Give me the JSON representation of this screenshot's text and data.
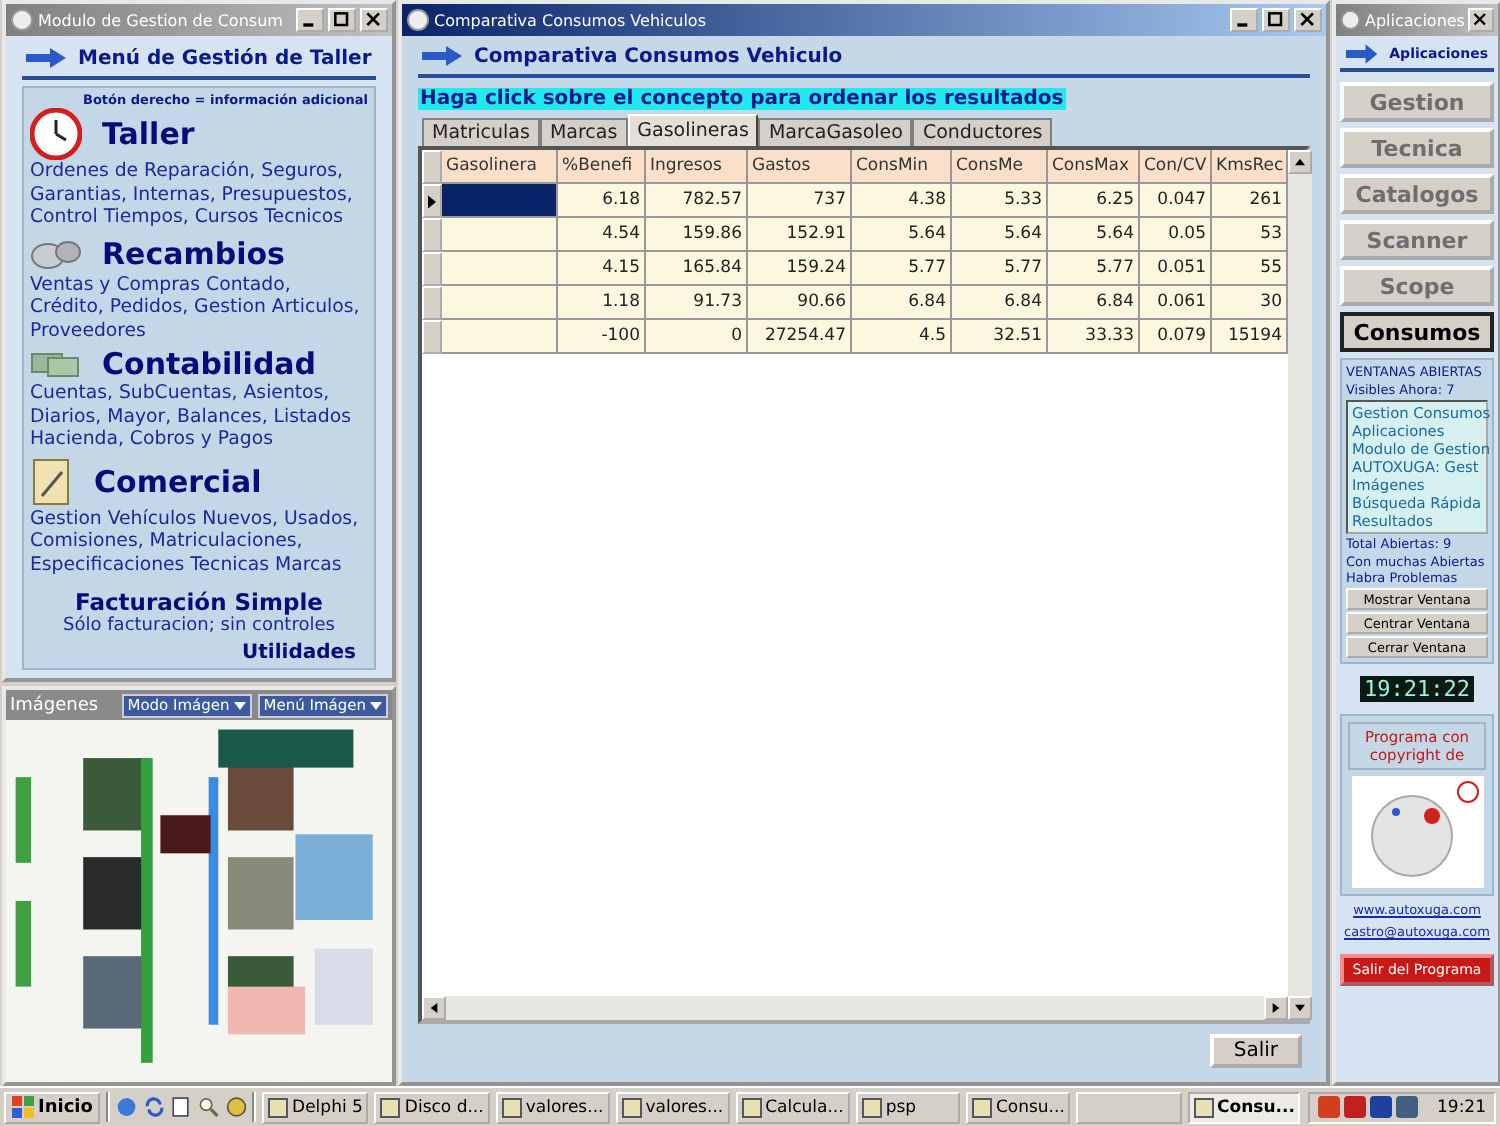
{
  "left_window": {
    "title": "Modulo de Gestion de Consum",
    "header": "Menú de Gestión de Taller",
    "hint": "Botón derecho = información adicional",
    "sections": [
      {
        "kind": "clock",
        "title": "Taller",
        "text": "Ordenes de Reparación, Seguros, Garantias, Internas, Presupuestos, Control Tiempos, Cursos Tecnicos"
      },
      {
        "kind": "parts",
        "title": "Recambios",
        "text": "Ventas y Compras Contado, Crédito, Pedidos,  Gestion Articulos, Proveedores"
      },
      {
        "kind": "money",
        "title": "Contabilidad",
        "text": "Cuentas, SubCuentas, Asientos, Diarios, Mayor, Balances, Listados Hacienda, Cobros y Pagos"
      },
      {
        "kind": "notepad",
        "title": "Comercial",
        "text": "Gestion Vehículos Nuevos, Usados, Comisiones, Matriculaciones, Especificaciones Tecnicas Marcas"
      }
    ],
    "simple": {
      "title": "Facturación Simple",
      "text": "Sólo facturacion; sin controles"
    },
    "utilities": "Utilidades"
  },
  "images_panel": {
    "title": "Imágenes",
    "menus": [
      "Modo Imágen",
      "Menú Imágen"
    ],
    "kind": "picture"
  },
  "main_window": {
    "title": "Comparativa Consumos Vehiculos",
    "header": "Comparativa Consumos Vehiculo",
    "instruction": "Haga click sobre el concepto para ordenar los resultados",
    "tabs": [
      {
        "label": "Matriculas",
        "selected": false
      },
      {
        "label": "Marcas",
        "selected": false
      },
      {
        "label": "Gasolineras",
        "selected": true
      },
      {
        "label": "MarcaGasoleo",
        "selected": false
      },
      {
        "label": "Conductores",
        "selected": false
      }
    ],
    "table": {
      "columns": [
        "Gasolinera",
        "%Benefi",
        "Ingresos",
        "Gastos",
        "ConsMin",
        "ConsMe",
        "ConsMax",
        "Con/CV",
        "KmsRec"
      ],
      "rows": [
        {
          "selected": true,
          "cells": [
            "",
            "6.18",
            "782.57",
            "737",
            "4.38",
            "5.33",
            "6.25",
            "0.047",
            "261"
          ]
        },
        {
          "selected": false,
          "cells": [
            "",
            "4.54",
            "159.86",
            "152.91",
            "5.64",
            "5.64",
            "5.64",
            "0.05",
            "53"
          ]
        },
        {
          "selected": false,
          "cells": [
            "",
            "4.15",
            "165.84",
            "159.24",
            "5.77",
            "5.77",
            "5.77",
            "0.051",
            "55"
          ]
        },
        {
          "selected": false,
          "cells": [
            "",
            "1.18",
            "91.73",
            "90.66",
            "6.84",
            "6.84",
            "6.84",
            "0.061",
            "30"
          ]
        },
        {
          "selected": false,
          "cells": [
            "",
            "-100",
            "0",
            "27254.47",
            "4.5",
            "32.51",
            "33.33",
            "0.079",
            "15194"
          ]
        }
      ]
    },
    "close_button": "Salir"
  },
  "apps_window": {
    "title": "Aplicaciones",
    "header": "Aplicaciones",
    "apps": [
      {
        "label": "Gestion",
        "selected": false
      },
      {
        "label": "Tecnica",
        "selected": false
      },
      {
        "label": "Catalogos",
        "selected": false
      },
      {
        "label": "Scanner",
        "selected": false
      },
      {
        "label": "Scope",
        "selected": false
      },
      {
        "label": "Consumos",
        "selected": true
      }
    ],
    "open_windows": {
      "title": "VENTANAS ABIERTAS",
      "visible": "Visibles Ahora: 7",
      "items": [
        "Gestion Consumos",
        "Aplicaciones",
        "Modulo de Gestion",
        "AUTOXUGA:  Gest",
        "Imágenes",
        "Búsqueda Rápida",
        "Resultados"
      ],
      "total": "Total Abiertas: 9",
      "warning": "Con muchas Abiertas Habra Problemas",
      "buttons": [
        "Mostrar Ventana",
        "Centrar Ventana",
        "Cerrar Ventana"
      ]
    },
    "clock": "19:21:22",
    "copyright": "Programa con copyright de",
    "links": [
      "www.autoxuga.com",
      "castro@autoxuga.com"
    ],
    "exit_button": "Salir del Programa"
  },
  "taskbar": {
    "start": "Inicio",
    "tasks": [
      {
        "label": "Delphi 5",
        "selected": false
      },
      {
        "label": "Disco d...",
        "selected": false
      },
      {
        "label": "valores...",
        "selected": false
      },
      {
        "label": "valores...",
        "selected": false
      },
      {
        "label": "Calcula...",
        "selected": false
      },
      {
        "label": "psp",
        "selected": false
      },
      {
        "label": "Consu...",
        "selected": false
      },
      {
        "label": "Consu...",
        "selected": true
      }
    ],
    "time": "19:21"
  }
}
